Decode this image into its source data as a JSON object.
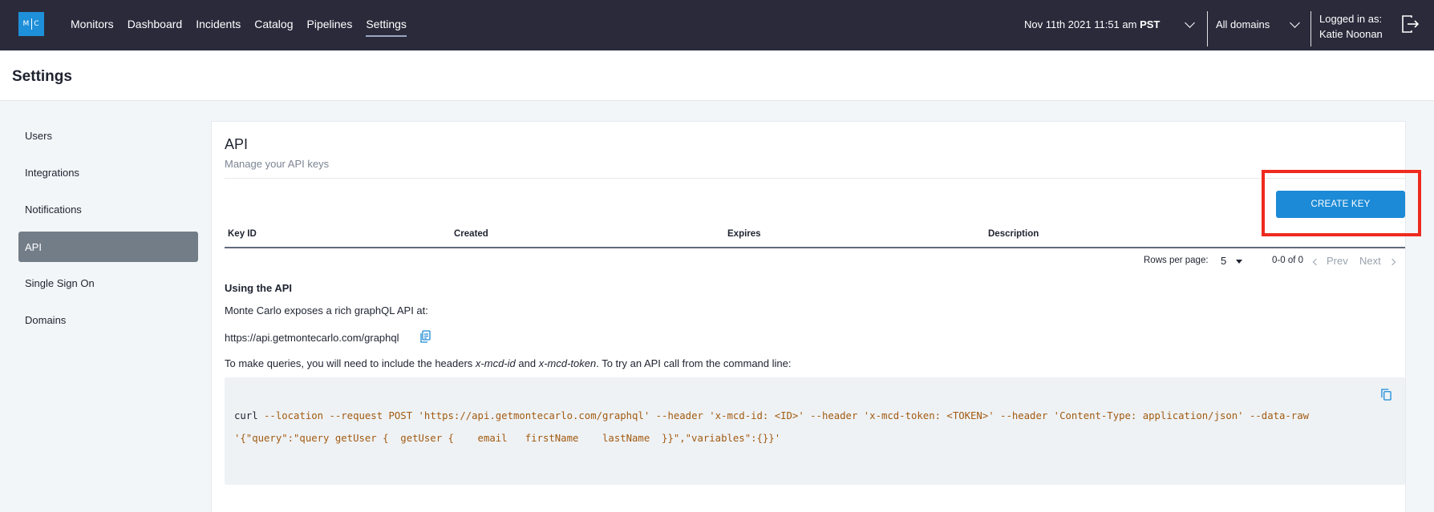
{
  "nav": {
    "logo_left": "M",
    "logo_right": "C",
    "links": [
      {
        "label": "Monitors"
      },
      {
        "label": "Dashboard"
      },
      {
        "label": "Incidents"
      },
      {
        "label": "Catalog"
      },
      {
        "label": "Pipelines"
      },
      {
        "label": "Settings",
        "active": true
      }
    ],
    "date_text": "Nov 11th 2021 11:51 am",
    "timezone": "PST",
    "domain_select": "All domains",
    "logged_in_label": "Logged in as:",
    "user_name": "Katie Noonan"
  },
  "page": {
    "title": "Settings"
  },
  "sidebar": {
    "items": [
      {
        "label": "Users"
      },
      {
        "label": "Integrations"
      },
      {
        "label": "Notifications"
      },
      {
        "label": "API",
        "active": true
      },
      {
        "label": "Single Sign On"
      },
      {
        "label": "Domains"
      }
    ]
  },
  "api": {
    "title": "API",
    "subtitle": "Manage your API keys",
    "create_button": "CREATE KEY",
    "table": {
      "columns": [
        "Key ID",
        "Created",
        "Expires",
        "Description"
      ],
      "rows": []
    },
    "pagination": {
      "rows_per_page_label": "Rows per page:",
      "rows_per_page_value": "5",
      "range": "0-0 of 0",
      "prev": "Prev",
      "next": "Next"
    },
    "usage": {
      "heading": "Using the API",
      "intro": "Monte Carlo exposes a rich graphQL API at:",
      "endpoint": "https://api.getmontecarlo.com/graphql",
      "headers_pre": "To make queries, you will need to include the headers ",
      "header_id": "x-mcd-id",
      "headers_and": " and ",
      "header_token": "x-mcd-token",
      "headers_post": ". To try an API call from the command line:",
      "code_cmd": "curl",
      "code_line1": " --location --request POST 'https://api.getmontecarlo.com/graphql' --header 'x-mcd-id: <ID>' --header 'x-mcd-token: <TOKEN>' --header 'Content-Type: application/json' --data-raw",
      "code_line2": "'{\"query\":\"query getUser {  getUser {    email   firstName    lastName  }}\",\"variables\":{}}'"
    }
  },
  "colors": {
    "nav_bg": "#2b2a3b",
    "accent": "#1c8ad6",
    "sidebar_active": "#727d88",
    "highlight": "#ef2a1f",
    "code_text": "#a35a10"
  }
}
